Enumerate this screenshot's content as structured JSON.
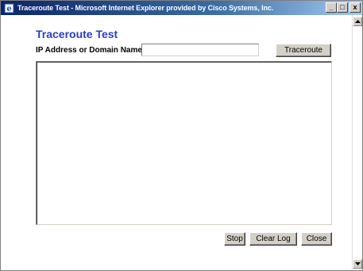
{
  "window": {
    "title": "Traceroute Test - Microsoft Internet Explorer provided by Cisco Systems, Inc.",
    "minimize_glyph": "_",
    "maximize_glyph": "□",
    "close_glyph": "x"
  },
  "page": {
    "title": "Traceroute Test",
    "ip_label": "IP Address or Domain Name:",
    "ip_value": "",
    "traceroute_label": "Traceroute",
    "log_text": "",
    "stop_label": "Stop",
    "clear_log_label": "Clear Log",
    "close_label": "Close"
  },
  "icons": {
    "app": "ie-icon",
    "scroll_up": "arrow-up-icon",
    "scroll_down": "arrow-down-icon"
  },
  "colors": {
    "heading": "#2a3ec2",
    "titlebar": "#0a246a"
  }
}
